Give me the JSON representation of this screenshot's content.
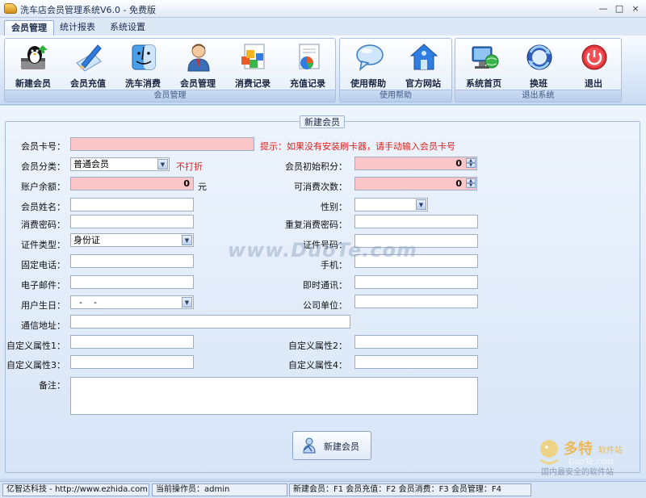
{
  "window": {
    "title": "洗车店会员管理系统V6.0 - 免费版",
    "min": "—",
    "max": "□",
    "close": "×"
  },
  "tabs": [
    "会员管理",
    "统计报表",
    "系统设置"
  ],
  "ribbon": {
    "groups": [
      {
        "label": "会员管理",
        "buttons": [
          "新建会员",
          "会员充值",
          "洗车消费",
          "会员管理",
          "消费记录",
          "充值记录"
        ]
      },
      {
        "label": "使用帮助",
        "buttons": [
          "使用帮助",
          "官方网站"
        ]
      },
      {
        "label": "退出系统",
        "buttons": [
          "系统首页",
          "换班",
          "退出"
        ]
      }
    ]
  },
  "form": {
    "legend": "新建会员",
    "card_no": {
      "label": "会员卡号：",
      "value": ""
    },
    "hint": "提示：如果没有安装刷卡器，请手动输入会员卡号",
    "category": {
      "label": "会员分类：",
      "value": "普通会员"
    },
    "discount_note": "不打折",
    "init_points": {
      "label": "会员初始积分：",
      "value": "0"
    },
    "balance": {
      "label": "账户余额：",
      "value": "0",
      "unit": "元"
    },
    "times": {
      "label": "可消费次数：",
      "value": "0"
    },
    "name": {
      "label": "会员姓名：",
      "value": ""
    },
    "gender": {
      "label": "性别：",
      "value": ""
    },
    "pwd": {
      "label": "消费密码：",
      "value": ""
    },
    "pwd2": {
      "label": "重复消费密码：",
      "value": ""
    },
    "id_type": {
      "label": "证件类型：",
      "value": "身份证"
    },
    "id_no": {
      "label": "证件号码：",
      "value": ""
    },
    "phone": {
      "label": "固定电话：",
      "value": ""
    },
    "mobile": {
      "label": "手机：",
      "value": ""
    },
    "email": {
      "label": "电子邮件：",
      "value": ""
    },
    "im": {
      "label": "即时通讯：",
      "value": ""
    },
    "birthday": {
      "label": "用户生日：",
      "value": "-    -"
    },
    "company": {
      "label": "公司单位：",
      "value": ""
    },
    "address": {
      "label": "通信地址：",
      "value": ""
    },
    "attr1": {
      "label": "自定义属性1：",
      "value": ""
    },
    "attr2": {
      "label": "自定义属性2：",
      "value": ""
    },
    "attr3": {
      "label": "自定义属性3：",
      "value": ""
    },
    "attr4": {
      "label": "自定义属性4：",
      "value": ""
    },
    "remark": {
      "label": "备注：",
      "value": ""
    },
    "submit": "新建会员"
  },
  "watermark": "www.DuoTe.com",
  "logo_watermark": {
    "brand": "多特",
    "sub": "软件站",
    "url": "DuoTe.com",
    "tagline": "国内最安全的软件站"
  },
  "status": {
    "company": "亿智达科技 - http://www.ezhida.com",
    "operator": "当前操作员：admin",
    "shortcuts": "新建会员：F1   会员充值：F2   会员消费：F3   会员管理：F4"
  },
  "colors": {
    "pink_field": "#fbc6c8",
    "hint": "#e0201a",
    "ribbon_bg": "#dbe8f8"
  }
}
